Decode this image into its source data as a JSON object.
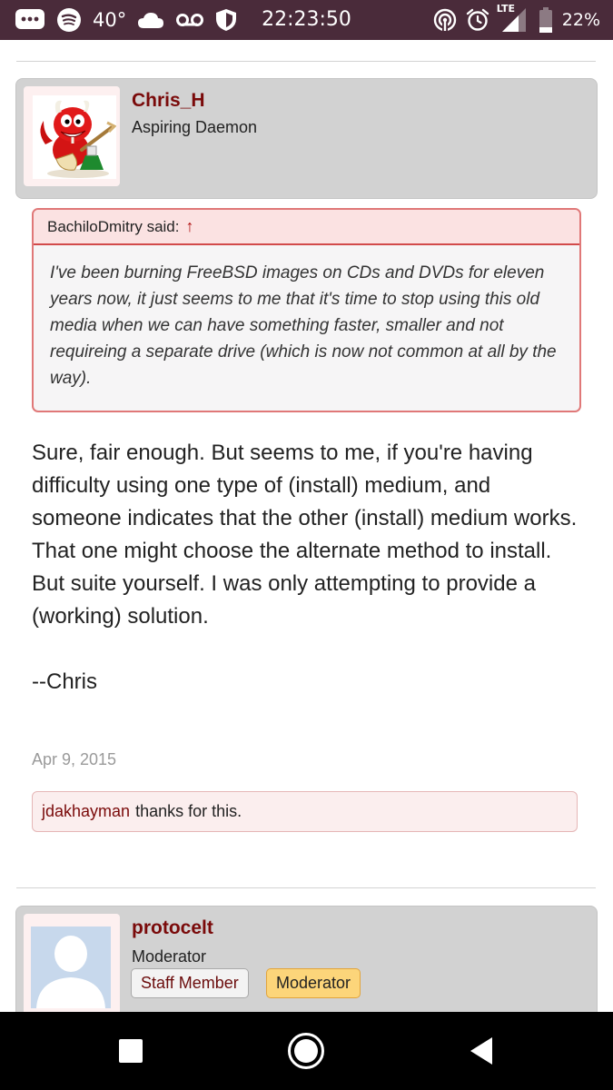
{
  "status_bar": {
    "temperature": "40°",
    "time": "22:23:50",
    "network": "LTE",
    "battery": "22%",
    "icons": [
      "message-icon",
      "spotify-icon",
      "cloud-icon",
      "voicemail-icon",
      "shield-icon",
      "hotspot-icon",
      "alarm-icon",
      "signal-icon",
      "battery-icon"
    ]
  },
  "posts": [
    {
      "author": "Chris_H",
      "user_title": "Aspiring Daemon",
      "avatar": "bsd-daemon-avatar",
      "quote": {
        "author_label": "BachiloDmitry said:",
        "arrow": "↑",
        "text": "I've been burning FreeBSD images on CDs and DVDs for eleven years now, it just seems to me that it's time to stop using this old media when we can have something faster, smaller and not requireing a separate drive (which is now not common at all by the way)."
      },
      "body": [
        "Sure, fair enough. But seems to me, if you're having difficulty using one type of (install) medium, and someone indicates that the other (install) medium works. That one might choose the alternate method to install.",
        "But suite yourself. I was only attempting to provide a (working) solution."
      ],
      "signature": "--Chris",
      "date": "Apr 9, 2015",
      "likes": {
        "user": "jdakhayman",
        "text": "thanks for this."
      }
    },
    {
      "author": "protocelt",
      "user_title": "Moderator",
      "avatar": "default-avatar",
      "badges": [
        "Staff Member",
        "Moderator"
      ]
    }
  ],
  "colors": {
    "status_bar": "#4a2b3a",
    "username": "#7a0a0a",
    "quote_border": "#e07878",
    "moderator_badge": "#fcd57a"
  },
  "nav_bar": [
    "recents-square-icon",
    "home-circle-icon",
    "back-triangle-icon"
  ]
}
